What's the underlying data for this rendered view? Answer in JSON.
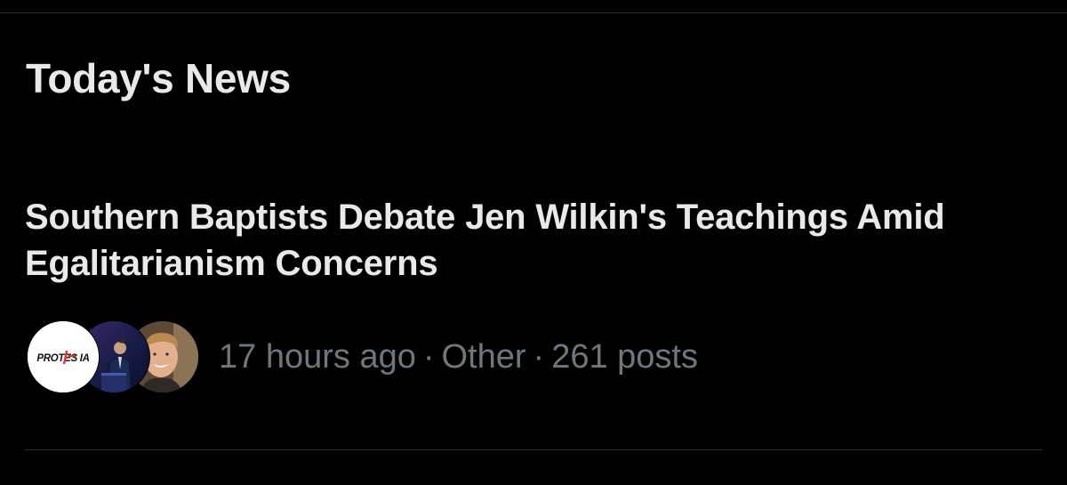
{
  "section": {
    "title": "Today's News"
  },
  "trend": {
    "headline": "Southern Baptists Debate Jen Wilkin's Teachings Amid Egalitarianism Concerns",
    "time": "17 hours ago",
    "category": "Other",
    "posts": "261 posts",
    "separator": "·",
    "avatars": [
      {
        "icon": "protestia-logo-avatar",
        "logo_text": "PROTESTIA"
      },
      {
        "icon": "speaker-at-podium-avatar"
      },
      {
        "icon": "smiling-man-avatar"
      }
    ]
  },
  "colors": {
    "background": "#000000",
    "primary_text": "#e7e9ea",
    "secondary_text": "#71767b",
    "divider": "#2f3336",
    "logo_accent": "#e0352b"
  }
}
